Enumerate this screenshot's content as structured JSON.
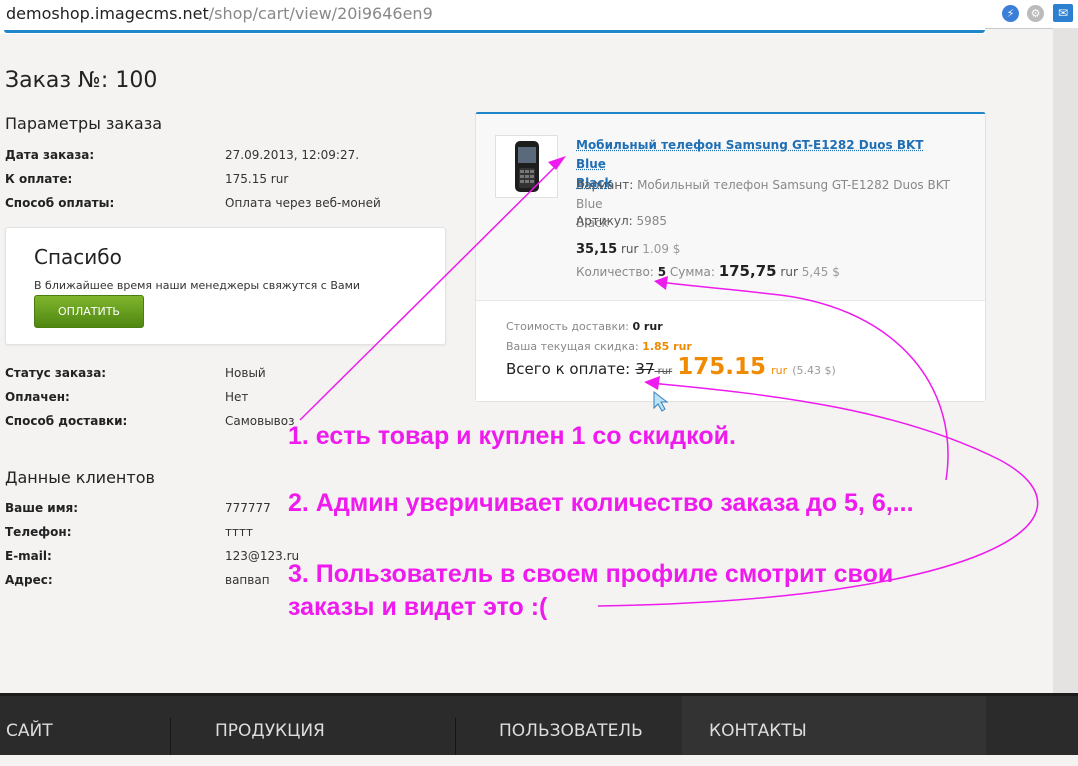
{
  "browser": {
    "url_host": "demoshop.imagecms.net",
    "url_path": "/shop/cart/view/20i9646en9"
  },
  "order": {
    "title": "Заказ №: 100",
    "params_heading": "Параметры заказа",
    "params": [
      {
        "label": "Дата заказа:",
        "value": "27.09.2013, 12:09:27."
      },
      {
        "label": "К оплате:",
        "value": "175.15 rur"
      },
      {
        "label": "Способ оплаты:",
        "value": "Оплата через веб-моней"
      }
    ],
    "thanks_title": "Спасибо",
    "thanks_text": "В ближайшее время наши менеджеры свяжутся с Вами",
    "pay_button": "ОПЛАТИТЬ",
    "status": [
      {
        "label": "Статус заказа:",
        "value": "Новый"
      },
      {
        "label": "Оплачен:",
        "value": "Нет"
      },
      {
        "label": "Способ доставки:",
        "value": "Самовывоз"
      }
    ],
    "client_heading": "Данные клиентов",
    "client": [
      {
        "label": "Ваше имя:",
        "value": "777777"
      },
      {
        "label": "Телефон:",
        "value": "тттт"
      },
      {
        "label": "E-mail:",
        "value": "123@123.ru"
      },
      {
        "label": "Адрес:",
        "value": "вапвап"
      }
    ]
  },
  "cart": {
    "product_name_1": "Мобильный телефон Samsung GT-E1282 Duos BKT Blue",
    "product_name_2": "Black",
    "variant_label": "Вариант:",
    "variant_value_1": "Мобильный телефон Samsung GT-E1282 Duos BKT Blue",
    "variant_value_2": "Black",
    "sku_label": "Артикул:",
    "sku_value": "5985",
    "price": "35,15",
    "price_cur": "rur",
    "price_alt": "1.09 $",
    "qty_label": "Количество:",
    "qty_value": "5",
    "sum_label": "Сумма:",
    "sum_value": "175,75",
    "sum_cur": "rur",
    "sum_alt": "5,45 $",
    "delivery_label": "Стоимость доставки:",
    "delivery_value": "0 rur",
    "discount_label": "Ваша текущая скидка:",
    "discount_value": "1.85 rur",
    "total_label": "Всего к оплате:",
    "total_old": "37",
    "total_old_cur": "rur",
    "total_value": "175.15",
    "total_cur": "rur",
    "total_alt": "(5.43 $)"
  },
  "footer_nav": [
    "САЙТ",
    "ПРОДУКЦИЯ",
    "ПОЛЬЗОВАТЕЛЬ",
    "КОНТАКТЫ"
  ],
  "annotations": [
    "1. есть товар и куплен 1 со скидкой.",
    "2. Админ уверичивает количество заказа до 5, 6,...",
    "3. Пользователь в своем профиле смотрит свои",
    "заказы и видет это :("
  ],
  "colors": {
    "accent_blue": "#1f86c9",
    "link_blue": "#1f6fb5",
    "price_orange": "#f08a00",
    "pay_green": "#5f9a1a",
    "annotation_magenta": "#ee1aee"
  }
}
